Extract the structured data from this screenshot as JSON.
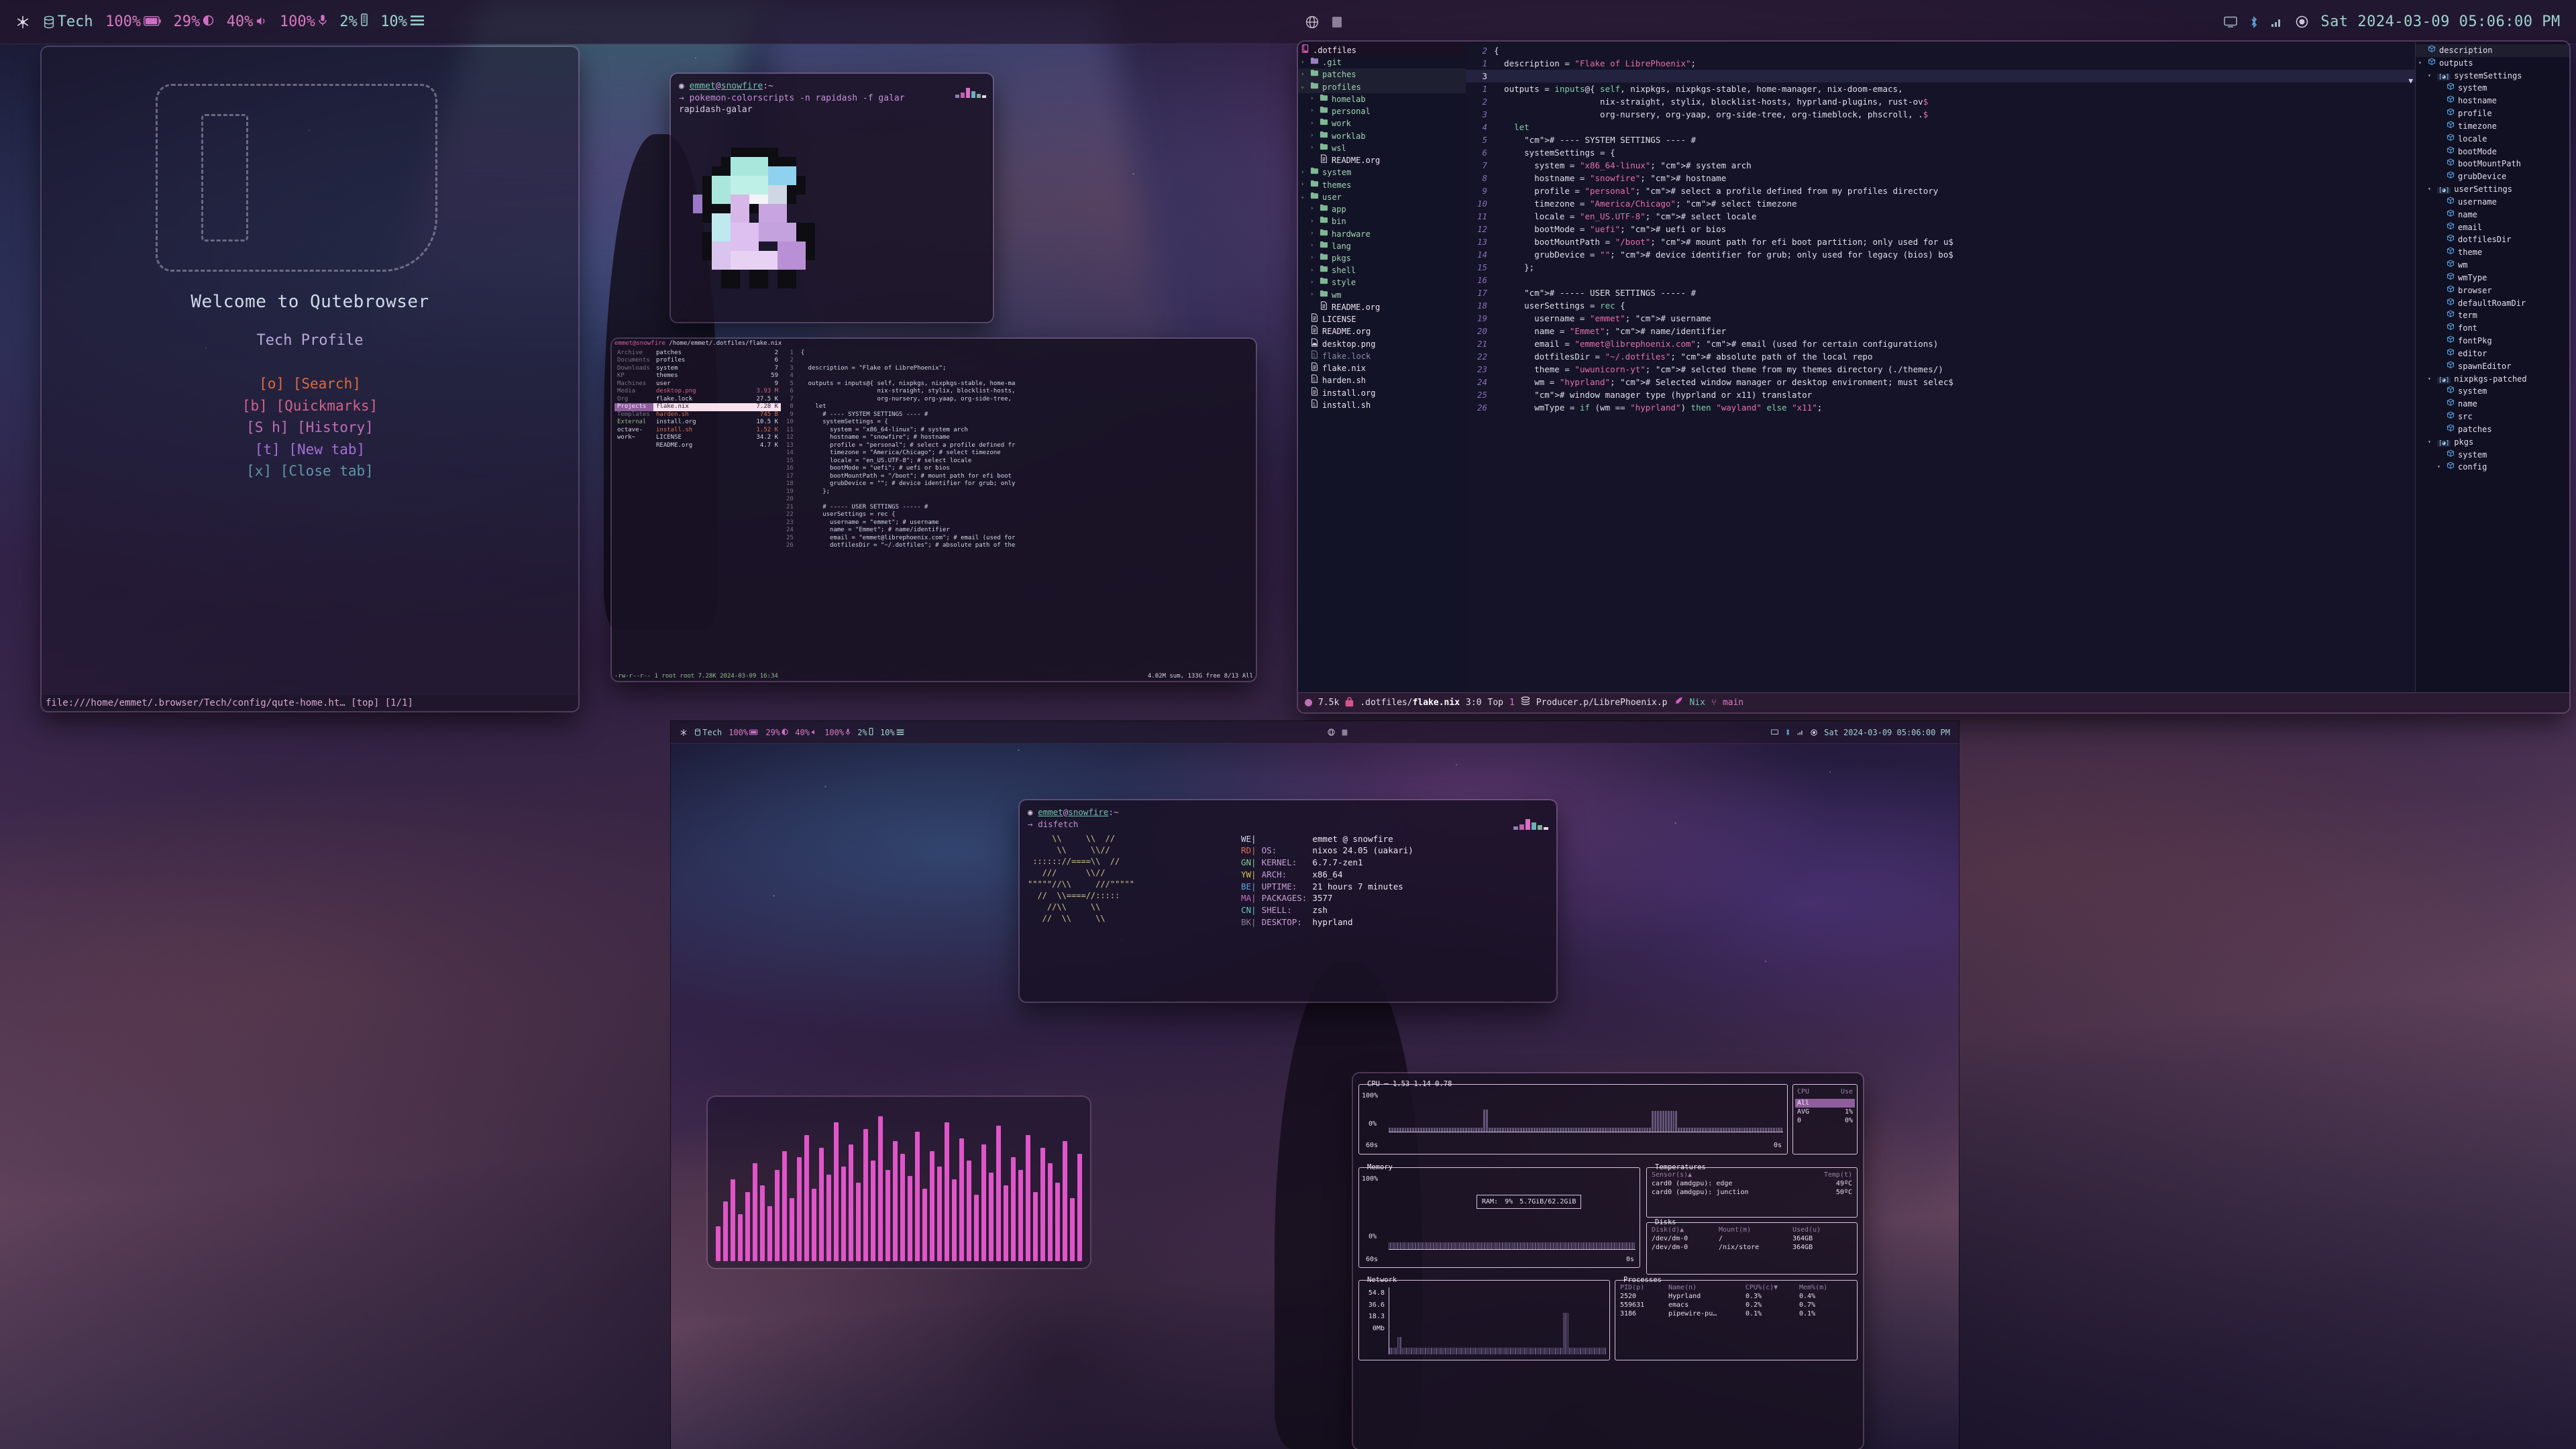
{
  "desktop": {
    "wallpaper_desc": "anime figure under aurora sky"
  },
  "topbar": {
    "workspace_icon": "nix-snowflake-icon",
    "profile_icon": "database-icon",
    "profile_label": "Tech",
    "battery_pct": "100%",
    "battery_icon": "battery-icon",
    "cpu_pct": "29%",
    "cpu_icon": "cpu-contrast-icon",
    "volume_pct": "40%",
    "volume_icon": "speaker-icon",
    "mic_pct": "100%",
    "mic_icon": "microphone-icon",
    "mem_pct": "2%",
    "mem_icon": "memory-icon",
    "disk_pct": "10%",
    "disk_icon": "hamburger-icon",
    "center_icons": [
      "globe-icon",
      "window-icon"
    ],
    "tray_icons": [
      "display-icon",
      "bluetooth-icon",
      "network-icon",
      "power-icon"
    ],
    "clock": "Sat 2024-03-09 05:06:00 PM"
  },
  "qutebrowser": {
    "title": "Welcome to Qutebrowser",
    "subtitle": "Tech Profile",
    "links": [
      {
        "key": "[o]",
        "label": "[Search]",
        "color": "#e06a3c"
      },
      {
        "key": "[b]",
        "label": "[Quickmarks]",
        "color": "#d4628c"
      },
      {
        "key": "[S h]",
        "label": "[History]",
        "color": "#c06fb8"
      },
      {
        "key": "[t]",
        "label": "[New tab]",
        "color": "#a46fd8"
      },
      {
        "key": "[x]",
        "label": "[Close tab]",
        "color": "#5c97a8"
      }
    ],
    "statusbar": "file:///home/emmet/.browser/Tech/config/qute-home.ht… [top] [1/1]"
  },
  "pokemon_terminal": {
    "prompt_user": "emmet",
    "prompt_at": "@",
    "prompt_host": "snowfire",
    "prompt_path": ":~",
    "command_arrow": "→",
    "command": "pokemon-colorscripts -n rapidash -f galar",
    "output": "rapidash-galar"
  },
  "ranger": {
    "header_user": "emmet@snowfire",
    "header_path": "/home/emmet/.dotfiles/flake.nix",
    "parent_col": [
      "Archive",
      "Documents",
      "Downloads",
      "KP",
      "Machines",
      "Media",
      "Org",
      "Projects",
      "Templates",
      "External",
      "octave-work~"
    ],
    "parent_selected": "Projects",
    "files": [
      {
        "name": "patches",
        "size": "2",
        "type": "dir"
      },
      {
        "name": "profiles",
        "size": "6",
        "type": "dir"
      },
      {
        "name": "system",
        "size": "7",
        "type": "dir"
      },
      {
        "name": "themes",
        "size": "59",
        "type": "dir"
      },
      {
        "name": "user",
        "size": "9",
        "type": "dir"
      },
      {
        "name": "desktop.png",
        "size": "3.93 M",
        "type": "png"
      },
      {
        "name": "flake.lock",
        "size": "27.5 K",
        "type": "file"
      },
      {
        "name": "flake.nix",
        "size": "7.28 K",
        "type": "file",
        "selected": true
      },
      {
        "name": "harden.sh",
        "size": "745 B",
        "type": "sh"
      },
      {
        "name": "install.org",
        "size": "10.5 K",
        "type": "file"
      },
      {
        "name": "install.sh",
        "size": "1.52 K",
        "type": "sh"
      },
      {
        "name": "LICENSE",
        "size": "34.2 K",
        "type": "file"
      },
      {
        "name": "README.org",
        "size": "4.7 K",
        "type": "file"
      }
    ],
    "preview_lines": [
      "{",
      "",
      "  description = \"Flake of LibrePhoenix\";",
      "",
      "  outputs = inputs@{ self, nixpkgs, nixpkgs-stable, home-ma",
      "                     nix-straight, stylix, blocklist-hosts,",
      "                     org-nursery, org-yaap, org-side-tree,",
      "    let",
      "      # ---- SYSTEM SETTINGS ---- #",
      "      systemSettings = {",
      "        system = \"x86_64-linux\"; # system arch",
      "        hostname = \"snowfire\"; # hostname",
      "        profile = \"personal\"; # select a profile defined fr",
      "        timezone = \"America/Chicago\"; # select timezone",
      "        locale = \"en_US.UTF-8\"; # select locale",
      "        bootMode = \"uefi\"; # uefi or bios",
      "        bootMountPath = \"/boot\"; # mount path for efi boot",
      "        grubDevice = \"\"; # device identifier for grub; only",
      "      };",
      "",
      "      # ----- USER SETTINGS ----- #",
      "      userSettings = rec {",
      "        username = \"emmet\"; # username",
      "        name = \"Emmet\"; # name/identifier",
      "        email = \"emmet@librephoenix.com\"; # email (used for",
      "        dotfilesDir = \"~/.dotfiles\"; # absolute path of the"
    ],
    "status_left": "-rw-r--r-- 1 root root 7.28K 2024-03-09 16:34",
    "status_right": "4.02M sum, 133G free  8/13  All"
  },
  "emacs": {
    "tree_root": "dotfiles",
    "tree_root_label": ".dotfiles",
    "tree": [
      {
        "depth": 0,
        "arrow": "›",
        "label": ".git",
        "kind": "dir-git"
      },
      {
        "depth": 0,
        "arrow": "›",
        "label": "patches",
        "kind": "dir",
        "hl": true
      },
      {
        "depth": 0,
        "arrow": "⌄",
        "label": "profiles",
        "kind": "dir",
        "hl": true
      },
      {
        "depth": 1,
        "arrow": "›",
        "label": "homelab",
        "kind": "dir"
      },
      {
        "depth": 1,
        "arrow": "›",
        "label": "personal",
        "kind": "dir"
      },
      {
        "depth": 1,
        "arrow": "›",
        "label": "work",
        "kind": "dir"
      },
      {
        "depth": 1,
        "arrow": "›",
        "label": "worklab",
        "kind": "dir"
      },
      {
        "depth": 1,
        "arrow": "›",
        "label": "wsl",
        "kind": "dir"
      },
      {
        "depth": 1,
        "arrow": "",
        "label": "README.org",
        "kind": "file-org"
      },
      {
        "depth": 0,
        "arrow": "›",
        "label": "system",
        "kind": "dir"
      },
      {
        "depth": 0,
        "arrow": "›",
        "label": "themes",
        "kind": "dir"
      },
      {
        "depth": 0,
        "arrow": "⌄",
        "label": "user",
        "kind": "dir"
      },
      {
        "depth": 1,
        "arrow": "›",
        "label": "app",
        "kind": "dir"
      },
      {
        "depth": 1,
        "arrow": "›",
        "label": "bin",
        "kind": "dir"
      },
      {
        "depth": 1,
        "arrow": "›",
        "label": "hardware",
        "kind": "dir"
      },
      {
        "depth": 1,
        "arrow": "›",
        "label": "lang",
        "kind": "dir"
      },
      {
        "depth": 1,
        "arrow": "›",
        "label": "pkgs",
        "kind": "dir"
      },
      {
        "depth": 1,
        "arrow": "›",
        "label": "shell",
        "kind": "dir"
      },
      {
        "depth": 1,
        "arrow": "›",
        "label": "style",
        "kind": "dir"
      },
      {
        "depth": 1,
        "arrow": "›",
        "label": "wm",
        "kind": "dir"
      },
      {
        "depth": 1,
        "arrow": "",
        "label": "README.org",
        "kind": "file-org"
      },
      {
        "depth": 0,
        "arrow": "",
        "label": "LICENSE",
        "kind": "file-org"
      },
      {
        "depth": 0,
        "arrow": "",
        "label": "README.org",
        "kind": "file-org"
      },
      {
        "depth": 0,
        "arrow": "",
        "label": "desktop.png",
        "kind": "file-img"
      },
      {
        "depth": 0,
        "arrow": "",
        "label": "flake.lock",
        "kind": "file-bin",
        "dim": true
      },
      {
        "depth": 0,
        "arrow": "",
        "label": "flake.nix",
        "kind": "file-org"
      },
      {
        "depth": 0,
        "arrow": "",
        "label": "harden.sh",
        "kind": "file-bin"
      },
      {
        "depth": 0,
        "arrow": "",
        "label": "install.org",
        "kind": "file-org"
      },
      {
        "depth": 0,
        "arrow": "",
        "label": "install.sh",
        "kind": "file-bin"
      }
    ],
    "code_lines": [
      {
        "num": "2",
        "text": "{",
        "cur": false
      },
      {
        "num": "1",
        "text": "  description = \"Flake of LibrePhoenix\";",
        "cur": false
      },
      {
        "num": "3",
        "text": "",
        "cur": true
      },
      {
        "num": "1",
        "text": "  outputs = inputs@{ self, nixpkgs, nixpkgs-stable, home-manager, nix-doom-emacs,",
        "cur": false
      },
      {
        "num": "2",
        "text": "                     nix-straight, stylix, blocklist-hosts, hyprland-plugins, rust-ov$",
        "cur": false
      },
      {
        "num": "3",
        "text": "                     org-nursery, org-yaap, org-side-tree, org-timeblock, phscroll, .$",
        "cur": false
      },
      {
        "num": "4",
        "text": "    let",
        "cur": false
      },
      {
        "num": "5",
        "text": "      # ---- SYSTEM SETTINGS ---- #",
        "cur": false
      },
      {
        "num": "6",
        "text": "      systemSettings = {",
        "cur": false
      },
      {
        "num": "7",
        "text": "        system = \"x86_64-linux\"; # system arch",
        "cur": false
      },
      {
        "num": "8",
        "text": "        hostname = \"snowfire\"; # hostname",
        "cur": false
      },
      {
        "num": "9",
        "text": "        profile = \"personal\"; # select a profile defined from my profiles directory",
        "cur": false
      },
      {
        "num": "10",
        "text": "        timezone = \"America/Chicago\"; # select timezone",
        "cur": false
      },
      {
        "num": "11",
        "text": "        locale = \"en_US.UTF-8\"; # select locale",
        "cur": false
      },
      {
        "num": "12",
        "text": "        bootMode = \"uefi\"; # uefi or bios",
        "cur": false
      },
      {
        "num": "13",
        "text": "        bootMountPath = \"/boot\"; # mount path for efi boot partition; only used for u$",
        "cur": false
      },
      {
        "num": "14",
        "text": "        grubDevice = \"\"; # device identifier for grub; only used for legacy (bios) bo$",
        "cur": false
      },
      {
        "num": "15",
        "text": "      };",
        "cur": false
      },
      {
        "num": "16",
        "text": "",
        "cur": false
      },
      {
        "num": "17",
        "text": "      # ----- USER SETTINGS ----- #",
        "cur": false
      },
      {
        "num": "18",
        "text": "      userSettings = rec {",
        "cur": false
      },
      {
        "num": "19",
        "text": "        username = \"emmet\"; # username",
        "cur": false
      },
      {
        "num": "20",
        "text": "        name = \"Emmet\"; # name/identifier",
        "cur": false
      },
      {
        "num": "21",
        "text": "        email = \"emmet@librephoenix.com\"; # email (used for certain configurations)",
        "cur": false
      },
      {
        "num": "22",
        "text": "        dotfilesDir = \"~/.dotfiles\"; # absolute path of the local repo",
        "cur": false
      },
      {
        "num": "23",
        "text": "        theme = \"uwunicorn-yt\"; # selcted theme from my themes directory (./themes/)",
        "cur": false
      },
      {
        "num": "24",
        "text": "        wm = \"hyprland\"; # Selected window manager or desktop environment; must selec$",
        "cur": false
      },
      {
        "num": "25",
        "text": "        # window manager type (hyprland or x11) translator",
        "cur": false
      },
      {
        "num": "26",
        "text": "        wmType = if (wm == \"hyprland\") then \"wayland\" else \"x11\";",
        "cur": false
      }
    ],
    "outline": [
      {
        "depth": 0,
        "caret": "",
        "label": "description",
        "kind": "cube",
        "hl": true
      },
      {
        "depth": 0,
        "caret": "▾",
        "label": "outputs",
        "kind": "cube"
      },
      {
        "depth": 1,
        "caret": "▾",
        "label": "systemSettings",
        "kind": "brackets"
      },
      {
        "depth": 2,
        "caret": "",
        "label": "system",
        "kind": "cube"
      },
      {
        "depth": 2,
        "caret": "",
        "label": "hostname",
        "kind": "cube"
      },
      {
        "depth": 2,
        "caret": "",
        "label": "profile",
        "kind": "cube"
      },
      {
        "depth": 2,
        "caret": "",
        "label": "timezone",
        "kind": "cube"
      },
      {
        "depth": 2,
        "caret": "",
        "label": "locale",
        "kind": "cube"
      },
      {
        "depth": 2,
        "caret": "",
        "label": "bootMode",
        "kind": "cube"
      },
      {
        "depth": 2,
        "caret": "",
        "label": "bootMountPath",
        "kind": "cube"
      },
      {
        "depth": 2,
        "caret": "",
        "label": "grubDevice",
        "kind": "cube"
      },
      {
        "depth": 1,
        "caret": "▾",
        "label": "userSettings",
        "kind": "brackets"
      },
      {
        "depth": 2,
        "caret": "",
        "label": "username",
        "kind": "cube"
      },
      {
        "depth": 2,
        "caret": "",
        "label": "name",
        "kind": "cube"
      },
      {
        "depth": 2,
        "caret": "",
        "label": "email",
        "kind": "cube"
      },
      {
        "depth": 2,
        "caret": "",
        "label": "dotfilesDir",
        "kind": "cube"
      },
      {
        "depth": 2,
        "caret": "",
        "label": "theme",
        "kind": "cube"
      },
      {
        "depth": 2,
        "caret": "",
        "label": "wm",
        "kind": "cube"
      },
      {
        "depth": 2,
        "caret": "",
        "label": "wmType",
        "kind": "cube"
      },
      {
        "depth": 2,
        "caret": "",
        "label": "browser",
        "kind": "cube"
      },
      {
        "depth": 2,
        "caret": "",
        "label": "defaultRoamDir",
        "kind": "cube"
      },
      {
        "depth": 2,
        "caret": "",
        "label": "term",
        "kind": "cube"
      },
      {
        "depth": 2,
        "caret": "",
        "label": "font",
        "kind": "cube"
      },
      {
        "depth": 2,
        "caret": "",
        "label": "fontPkg",
        "kind": "cube"
      },
      {
        "depth": 2,
        "caret": "",
        "label": "editor",
        "kind": "cube"
      },
      {
        "depth": 2,
        "caret": "",
        "label": "spawnEditor",
        "kind": "cube"
      },
      {
        "depth": 1,
        "caret": "▾",
        "label": "nixpkgs-patched",
        "kind": "brackets"
      },
      {
        "depth": 2,
        "caret": "",
        "label": "system",
        "kind": "cube"
      },
      {
        "depth": 2,
        "caret": "",
        "label": "name",
        "kind": "cube"
      },
      {
        "depth": 2,
        "caret": "",
        "label": "src",
        "kind": "cube"
      },
      {
        "depth": 2,
        "caret": "",
        "label": "patches",
        "kind": "cube"
      },
      {
        "depth": 1,
        "caret": "▾",
        "label": "pkgs",
        "kind": "brackets"
      },
      {
        "depth": 2,
        "caret": "",
        "label": "system",
        "kind": "cube"
      },
      {
        "depth": 2,
        "caret": "▾",
        "label": "config",
        "kind": "cube"
      }
    ],
    "modeline": {
      "size": "7.5k",
      "lock_icon": "lock-icon",
      "path_prefix": ".dotfiles/",
      "filename": "flake.nix",
      "position": "3:0",
      "scroll": "Top",
      "buffer_count": "1",
      "workspace_icon": "layers-icon",
      "workspace": "Producer.p/LibrePhoenix.p",
      "rocket_icon": "rocket-icon",
      "mode": "Nix",
      "branch_icon": "git-branch-icon",
      "branch": "main"
    }
  },
  "fetch_terminal": {
    "prompt_user": "emmet",
    "prompt_at": "@",
    "prompt_host": "snowfire",
    "prompt_path": ":~",
    "command_arrow": "→",
    "command": "disfetch",
    "ascii_art": "     \\\\     \\\\  //\n      \\\\     \\\\//\n :::::://====\\\\  //\n   ///      \\\\//\n\"\"\"\"\"//\\\\     ///\"\"\"\"\"\n  //  \\\\====//:::::\n    //\\\\     \\\\\n   //  \\\\     \\\\",
    "color_tags": [
      "WE",
      "RD",
      "GN",
      "YW",
      "BE",
      "MA",
      "CN",
      "BK"
    ],
    "rows": [
      {
        "key": "",
        "value": "emmet @ snowfire"
      },
      {
        "key": "OS:",
        "value": "nixos 24.05 (uakari)"
      },
      {
        "key": "KERNEL:",
        "value": "6.7.7-zen1"
      },
      {
        "key": "ARCH:",
        "value": "x86_64"
      },
      {
        "key": "UPTIME:",
        "value": "21 hours 7 minutes"
      },
      {
        "key": "PACKAGES:",
        "value": "3577"
      },
      {
        "key": "SHELL:",
        "value": "zsh"
      },
      {
        "key": "DESKTOP:",
        "value": "hyprland"
      }
    ]
  },
  "btop": {
    "cpu": {
      "title": "CPU",
      "load": "1.53 1.14 0.78",
      "y_top": "100%",
      "y_bottom": "0%",
      "x_left": "60s",
      "x_right": "0s",
      "side_header_1": "CPU",
      "side_header_2": "Use",
      "rows": [
        {
          "name": "All",
          "value": "",
          "selected": true
        },
        {
          "name": "AVG",
          "value": "1%"
        },
        {
          "name": "0",
          "value": "0%"
        }
      ]
    },
    "memory": {
      "title": "Memory",
      "y_top": "100%",
      "y_bottom": "0%",
      "x_left": "60s",
      "x_right": "0s",
      "ram_label": "RAM:",
      "ram_pct": "9%",
      "ram_usage": "5.7GiB/62.2GiB"
    },
    "temperatures": {
      "title": "Temperatures",
      "col_sensor": "Sensor(s)▲",
      "col_temp": "Temp(t)",
      "rows": [
        {
          "sensor": "card0 (amdgpu): edge",
          "temp": "49ºC"
        },
        {
          "sensor": "card0 (amdgpu): junction",
          "temp": "50ºC"
        }
      ]
    },
    "disks": {
      "title": "Disks",
      "col_disk": "Disk(d)▲",
      "col_mount": "Mount(m)",
      "col_used": "Used(u)",
      "rows": [
        {
          "disk": "/dev/dm-0",
          "mount": "/",
          "used": "364GB"
        },
        {
          "disk": "/dev/dm-0",
          "mount": "/nix/store",
          "used": "364GB"
        }
      ]
    },
    "network": {
      "title": "Network",
      "ticks": [
        "54.8",
        "36.6",
        "18.3",
        "0Mb"
      ]
    },
    "processes": {
      "title": "Processes",
      "col_pid": "PID(p)",
      "col_name": "Name(n)",
      "col_cpu": "CPU%(c)▼",
      "col_mem": "Mem%(m)",
      "rows": [
        {
          "pid": "2520",
          "name": "Hyprland",
          "cpu": "0.3%",
          "mem": "0.4%"
        },
        {
          "pid": "559631",
          "name": "emacs",
          "cpu": "0.2%",
          "mem": "0.7%"
        },
        {
          "pid": "3186",
          "name": "pipewire-pu…",
          "cpu": "0.1%",
          "mem": "0.1%"
        }
      ]
    }
  },
  "visualizer": {
    "name": "cava-audio-visualizer",
    "color": "#e055c8",
    "bars": [
      22,
      38,
      52,
      30,
      44,
      62,
      48,
      35,
      58,
      70,
      40,
      66,
      80,
      46,
      72,
      55,
      88,
      60,
      74,
      50,
      84,
      64,
      92,
      58,
      76,
      68,
      54,
      82,
      46,
      70,
      60,
      88,
      52,
      78,
      64,
      42,
      74,
      56,
      86,
      48,
      66,
      58,
      80,
      44,
      72,
      62,
      50,
      76,
      40,
      68
    ]
  }
}
